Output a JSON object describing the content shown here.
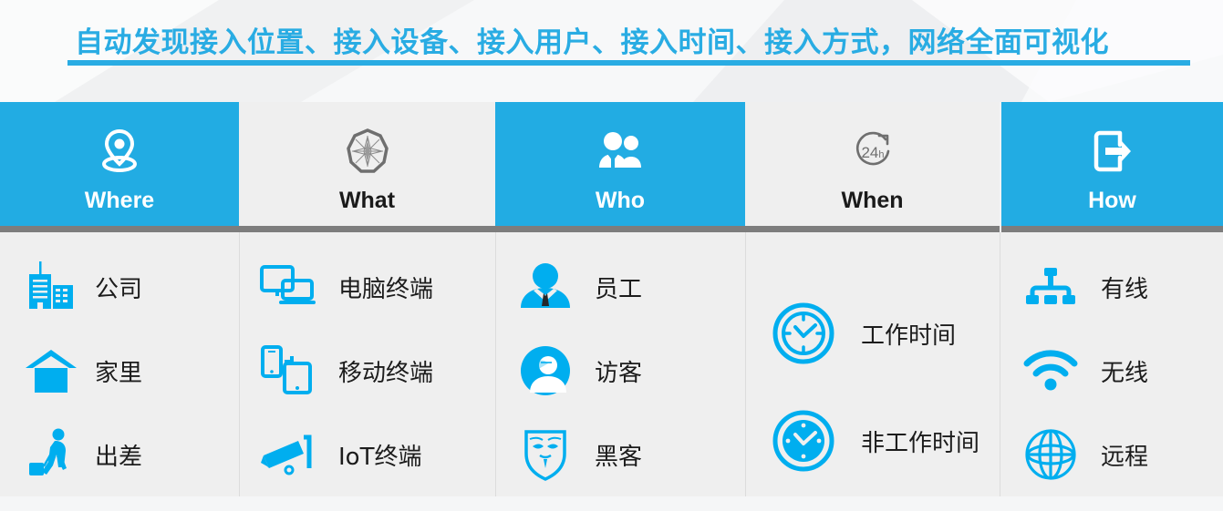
{
  "header": {
    "title": "自动发现接入位置、接入设备、接入用户、接入时间、接入方式，网络全面可视化"
  },
  "colors": {
    "accent_blue": "#22ace3",
    "title_blue": "#29ace3",
    "panel_gray": "#efefef",
    "divider_gray": "#7d7d7d",
    "text_dark": "#1c1c1c"
  },
  "columns": [
    {
      "key": "where",
      "label": "Where",
      "icon": "location-pin-icon",
      "highlight": true,
      "items": [
        {
          "label": "公司",
          "icon": "office-buildings-icon"
        },
        {
          "label": "家里",
          "icon": "house-icon"
        },
        {
          "label": "出差",
          "icon": "business-traveler-icon"
        }
      ]
    },
    {
      "key": "what",
      "label": "What",
      "icon": "compass-rose-icon",
      "highlight": false,
      "items": [
        {
          "label": "电脑终端",
          "icon": "desktop-laptop-icon"
        },
        {
          "label": "移动终端",
          "icon": "phone-tablet-icon"
        },
        {
          "label": "IoT终端",
          "icon": "security-camera-icon"
        }
      ]
    },
    {
      "key": "who",
      "label": "Who",
      "icon": "two-people-icon",
      "highlight": true,
      "items": [
        {
          "label": "员工",
          "icon": "employee-icon"
        },
        {
          "label": "访客",
          "icon": "visitor-avatar-icon"
        },
        {
          "label": "黑客",
          "icon": "hacker-mask-icon"
        }
      ]
    },
    {
      "key": "when",
      "label": "When",
      "icon": "24h-clock-icon",
      "highlight": false,
      "items": [
        {
          "label": "工作时间",
          "icon": "clock-outline-icon"
        },
        {
          "label": "非工作时间",
          "icon": "clock-filled-icon"
        }
      ]
    },
    {
      "key": "how",
      "label": "How",
      "icon": "exit-arrow-icon",
      "highlight": true,
      "items": [
        {
          "label": "有线",
          "icon": "wired-network-icon"
        },
        {
          "label": "无线",
          "icon": "wifi-icon"
        },
        {
          "label": "远程",
          "icon": "globe-icon"
        }
      ]
    }
  ]
}
